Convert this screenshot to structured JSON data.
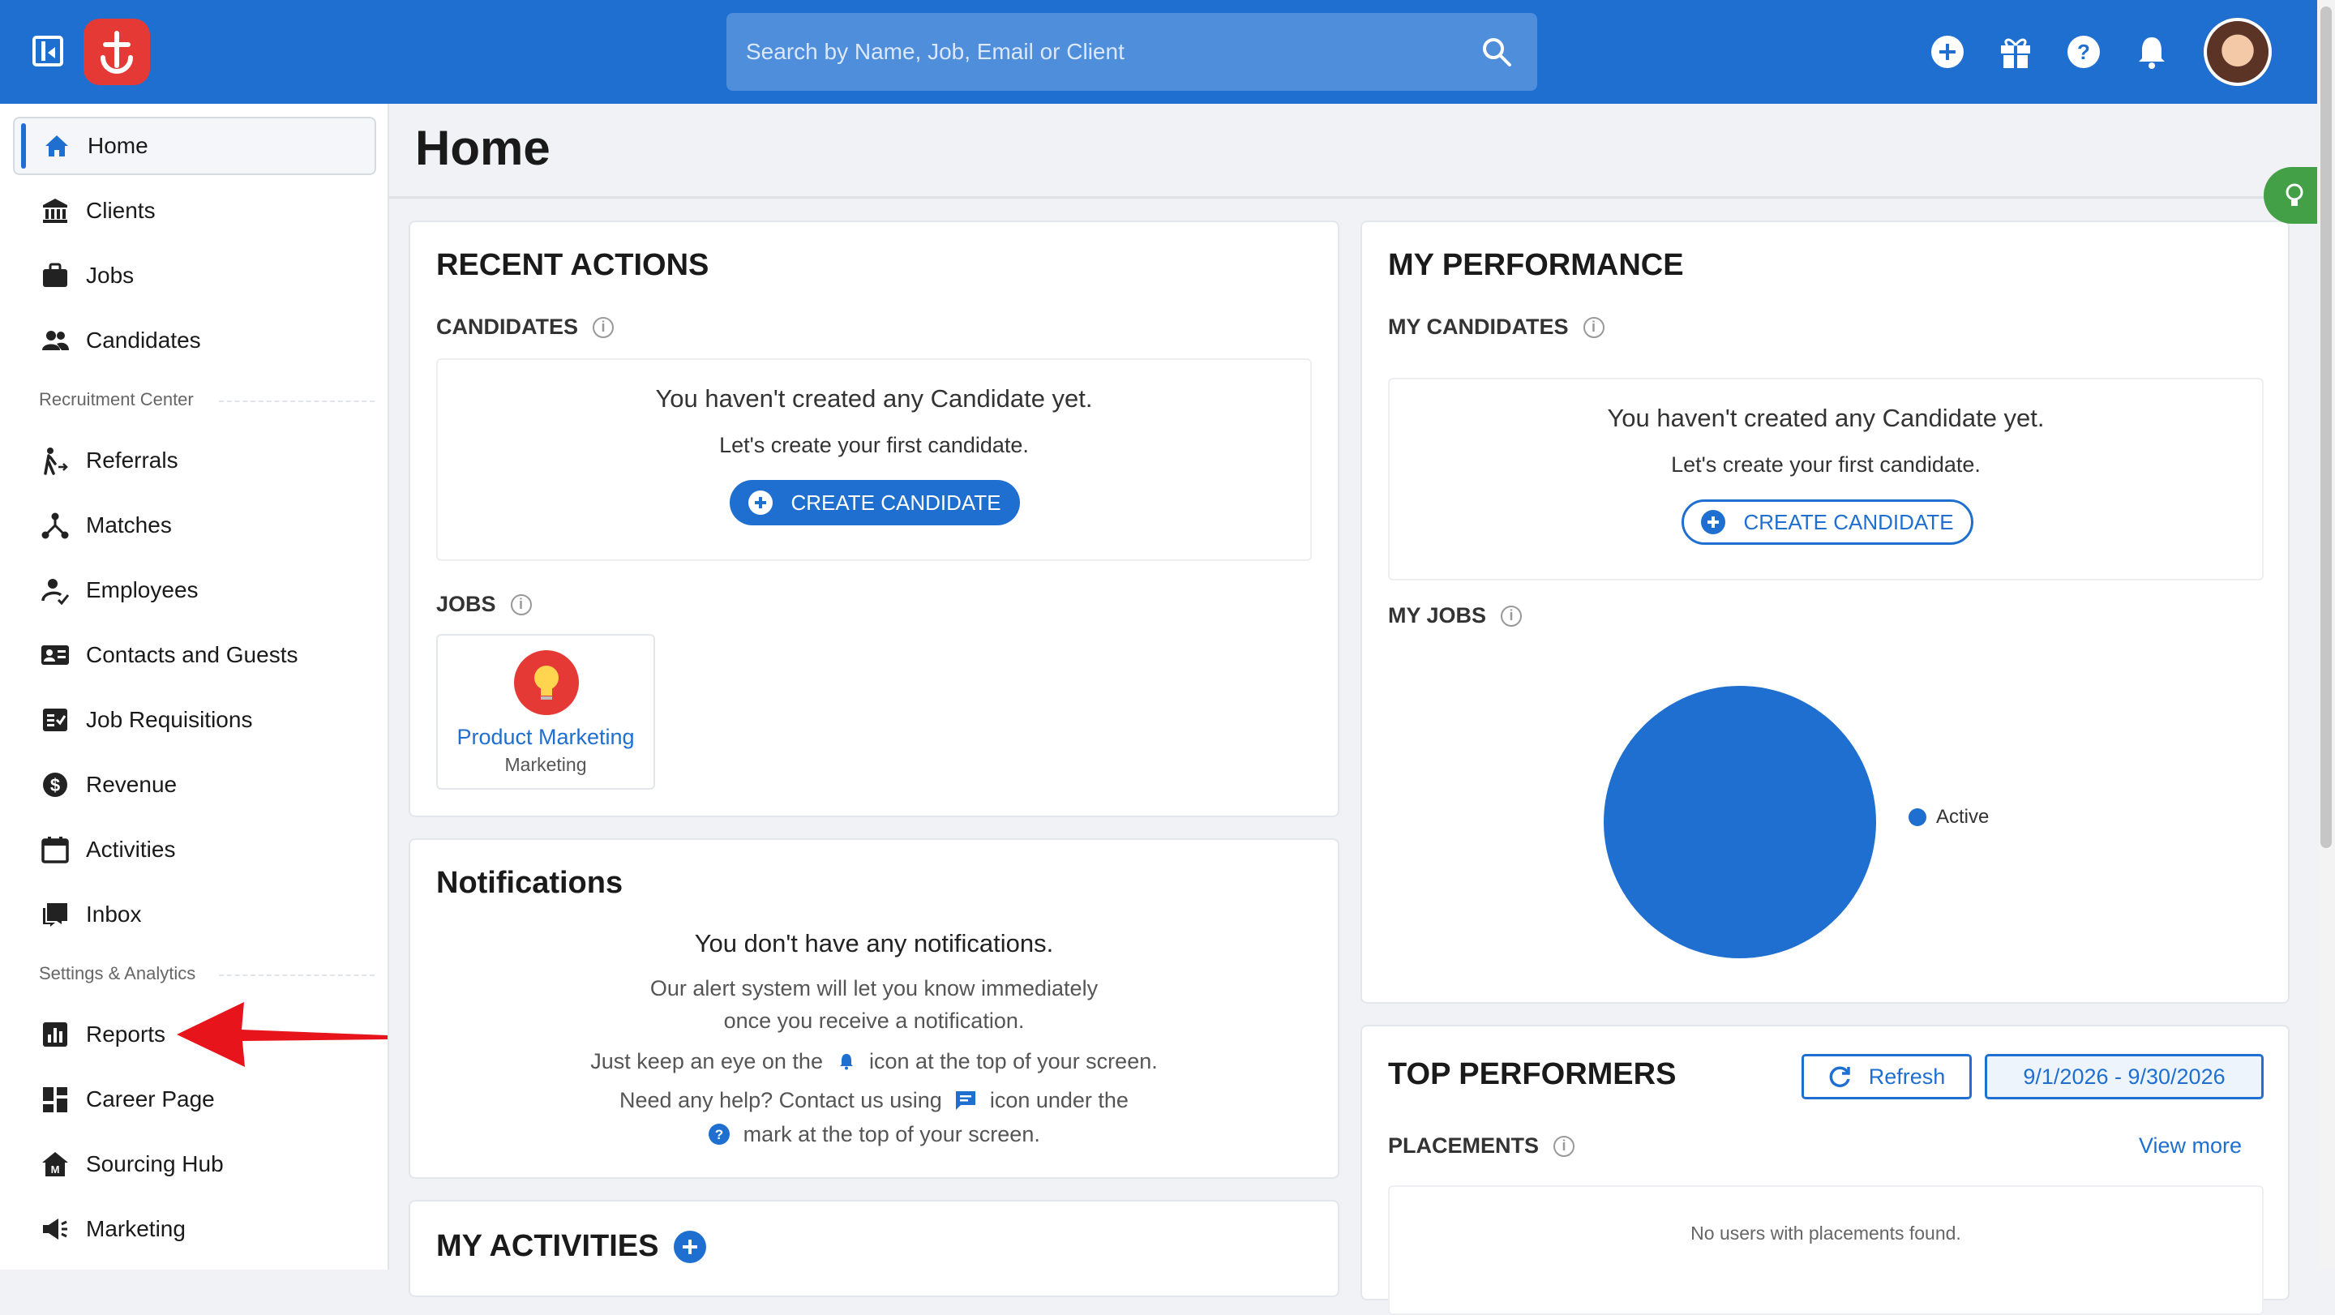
{
  "header": {
    "search_placeholder": "Search by Name, Job, Email or Client"
  },
  "sidebar": {
    "items": [
      {
        "label": "Home",
        "icon": "home-icon",
        "active": true
      },
      {
        "label": "Clients",
        "icon": "bank-icon"
      },
      {
        "label": "Jobs",
        "icon": "briefcase-icon"
      },
      {
        "label": "Candidates",
        "icon": "people-icon"
      }
    ],
    "section_recruitment": "Recruitment Center",
    "recruitment_items": [
      {
        "label": "Referrals",
        "icon": "referral-icon"
      },
      {
        "label": "Matches",
        "icon": "network-icon"
      },
      {
        "label": "Employees",
        "icon": "employee-icon"
      },
      {
        "label": "Contacts and Guests",
        "icon": "contacts-icon"
      },
      {
        "label": "Job Requisitions",
        "icon": "requisition-icon"
      },
      {
        "label": "Revenue",
        "icon": "dollar-icon"
      },
      {
        "label": "Activities",
        "icon": "calendar-icon"
      },
      {
        "label": "Inbox",
        "icon": "inbox-icon"
      }
    ],
    "section_settings": "Settings & Analytics",
    "settings_items": [
      {
        "label": "Reports",
        "icon": "bar-chart-icon"
      },
      {
        "label": "Career Page",
        "icon": "dashboard-icon"
      },
      {
        "label": "Sourcing Hub",
        "icon": "sourcing-icon"
      },
      {
        "label": "Marketing",
        "icon": "megaphone-icon"
      }
    ]
  },
  "page": {
    "title": "Home"
  },
  "recent_actions": {
    "title": "RECENT ACTIONS",
    "candidates_label": "CANDIDATES",
    "empty_title": "You haven't created any Candidate yet.",
    "empty_sub": "Let's create your first candidate.",
    "create_button": "CREATE CANDIDATE",
    "jobs_label": "JOBS",
    "job": {
      "title": "Product Marketing",
      "department": "Marketing"
    }
  },
  "notifications": {
    "title": "Notifications",
    "empty_title": "You don't have any notifications.",
    "line1": "Our alert system will let you know immediately",
    "line2": "once you receive a notification.",
    "line3a": "Just keep an eye on the",
    "line3b": "icon at the top of your screen.",
    "line4a": "Need any help? Contact us using",
    "line4b": "icon under the",
    "line5": "mark at the top of your screen."
  },
  "my_activities": {
    "title": "MY ACTIVITIES"
  },
  "my_performance": {
    "title": "MY PERFORMANCE",
    "candidates_label": "MY CANDIDATES",
    "empty_title": "You haven't created any Candidate yet.",
    "empty_sub": "Let's create your first candidate.",
    "create_button": "CREATE CANDIDATE",
    "jobs_label": "MY JOBS",
    "legend_active": "Active"
  },
  "chart_data": {
    "type": "pie",
    "series": [
      {
        "name": "Active",
        "values": [
          1
        ]
      }
    ],
    "categories": [
      "Active"
    ],
    "colors": [
      "#1e6fd0"
    ]
  },
  "top_performers": {
    "title": "TOP PERFORMERS",
    "refresh": "Refresh",
    "date_range": "9/1/2026 - 9/30/2026",
    "placements_label": "PLACEMENTS",
    "view_more": "View more",
    "empty": "No users with placements found."
  },
  "colors": {
    "primary": "#1e6fd0",
    "logo": "#e53935",
    "hint": "#43a047",
    "arrow": "#e8141b"
  }
}
